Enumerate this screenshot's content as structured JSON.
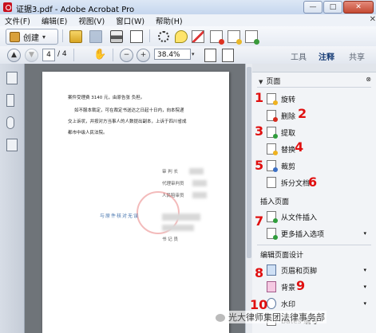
{
  "window": {
    "title": "证据3.pdf - Adobe Acrobat Pro",
    "min": "—",
    "max": "□",
    "close": "✕"
  },
  "menu": {
    "items": [
      "文件(F)",
      "编辑(E)",
      "视图(V)",
      "窗口(W)",
      "帮助(H)"
    ],
    "close": "✕"
  },
  "toolbar": {
    "create_label": "创建",
    "create_caret": "▾"
  },
  "nav": {
    "up": "▲",
    "down": "▼",
    "page_current": "4",
    "page_total": "/ 4",
    "hand": "✋",
    "zoom_out": "−",
    "zoom_in": "+",
    "zoom_value": "38.4%",
    "zoom_caret": "▾",
    "tabs": [
      "工具",
      "注释",
      "共享"
    ],
    "active_tab": "注释"
  },
  "doc": {
    "lines": [
      "案件受理费 3140 元，由原告张 负担。",
      "如不服本裁定，可在裁定书送达之日起十日内，向本院递",
      "交上诉状，并按对方当事人的人数提出副本，上诉于四川省成",
      "都市中级人民法院。"
    ],
    "sig": [
      "审 判 长",
      "代理审判员",
      "人民陪审员"
    ],
    "handwriting": "与原件核对无误",
    "footer": "书 记 员"
  },
  "panel": {
    "section_pages": "页面",
    "expand": "⊗",
    "tools_pages": [
      {
        "label": "旋转",
        "num": "1",
        "mark": "yl"
      },
      {
        "label": "删除",
        "num": "2",
        "mark": "rd"
      },
      {
        "label": "提取",
        "num": "3",
        "mark": "gn"
      },
      {
        "label": "替换",
        "num": "4",
        "mark": "yl"
      },
      {
        "label": "裁剪",
        "num": "5",
        "mark": "bl"
      },
      {
        "label": "拆分文档",
        "num": "6",
        "mark": ""
      }
    ],
    "section_insert": "插入页面",
    "tools_insert": [
      {
        "label": "从文件插入",
        "num": "7"
      },
      {
        "label": "更多插入选项",
        "caret": "▾"
      }
    ],
    "section_design": "编辑页面设计",
    "tools_design": [
      {
        "label": "页眉和页脚",
        "num": "8",
        "caret": "▾"
      },
      {
        "label": "背景",
        "num": "9",
        "caret": "▾"
      },
      {
        "label": "水印",
        "num": "10",
        "caret": "▾"
      },
      {
        "label": "Bates 编号",
        "caret": ""
      }
    ]
  },
  "watermark": "光大律师集团法律事务部"
}
